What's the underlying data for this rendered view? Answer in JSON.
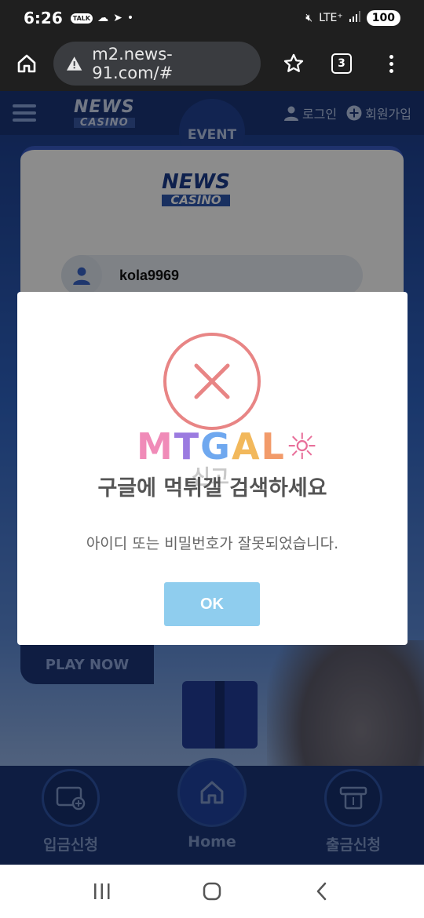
{
  "status_bar": {
    "time": "6:26",
    "talk_label": "TALK",
    "network": "LTE⁺",
    "battery": "100"
  },
  "browser": {
    "url": "m2.news-91.com/#",
    "tab_count": "3"
  },
  "site": {
    "logo_main": "NEWS",
    "logo_sub": "CASINO",
    "event_label": "EVENT",
    "login_label": "로그인",
    "signup_label": "회원가입",
    "username_value": "kola9969",
    "play_now_label": "PLAY NOW",
    "bottom_nav": {
      "deposit_label": "입금신청",
      "home_label": "Home",
      "withdraw_label": "출금신청"
    }
  },
  "modal": {
    "watermark_letters": [
      "M",
      "T",
      "G",
      "A",
      "L",
      "☼"
    ],
    "watermark_sub": "신고",
    "title": "구글에 먹튀갤 검색하세요",
    "message": "아이디 또는 비밀번호가 잘못되었습니다.",
    "ok_label": "OK",
    "error_color": "#e88585",
    "ok_color": "#8fcdee"
  }
}
